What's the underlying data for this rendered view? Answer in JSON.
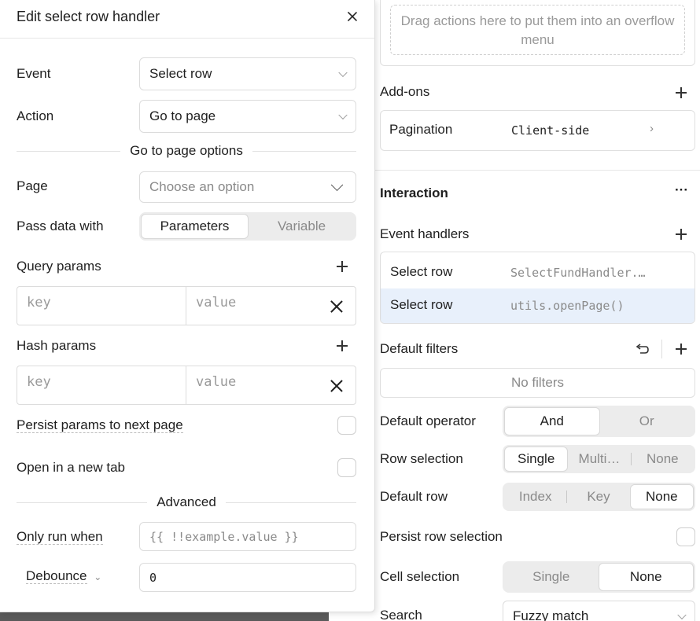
{
  "modal": {
    "title": "Edit select row handler",
    "event_label": "Event",
    "event_value": "Select row",
    "action_label": "Action",
    "action_value": "Go to page",
    "section_title": "Go to page options",
    "page_label": "Page",
    "page_placeholder": "Choose an option",
    "pass_data_label": "Pass data with",
    "pass_data_options": [
      "Parameters",
      "Variable"
    ],
    "pass_data_selected": "Parameters",
    "query_params_label": "Query params",
    "query_key_placeholder": "key",
    "query_value_placeholder": "value",
    "hash_params_label": "Hash params",
    "hash_key_placeholder": "key",
    "hash_value_placeholder": "value",
    "persist_params_label": "Persist params to next page",
    "open_new_tab_label": "Open in a new tab",
    "advanced_title": "Advanced",
    "only_run_when_label": "Only run when",
    "only_run_when_placeholder": "{{ !!example.value }}",
    "debounce_label": "Debounce",
    "debounce_value": "0"
  },
  "inspector": {
    "overflow_hint": "Drag actions here to put them into an overflow menu",
    "addons_label": "Add-ons",
    "pagination_label": "Pagination",
    "pagination_value": "Client-side",
    "interaction_title": "Interaction",
    "more_label": "···",
    "event_handlers_label": "Event handlers",
    "handlers": [
      {
        "event": "Select row",
        "action": "SelectFundHandler.…"
      },
      {
        "event": "Select row",
        "action": "utils.openPage()"
      }
    ],
    "default_filters_label": "Default filters",
    "no_filters": "No filters",
    "default_operator_label": "Default operator",
    "operator_options": [
      "And",
      "Or"
    ],
    "row_selection_label": "Row selection",
    "row_selection_options": [
      "Single",
      "Multi…",
      "None"
    ],
    "default_row_label": "Default row",
    "default_row_options": [
      "Index",
      "Key",
      "None"
    ],
    "persist_row_selection_label": "Persist row selection",
    "cell_selection_label": "Cell selection",
    "cell_selection_options": [
      "Single",
      "None"
    ],
    "search_label": "Search",
    "search_value": "Fuzzy match"
  }
}
